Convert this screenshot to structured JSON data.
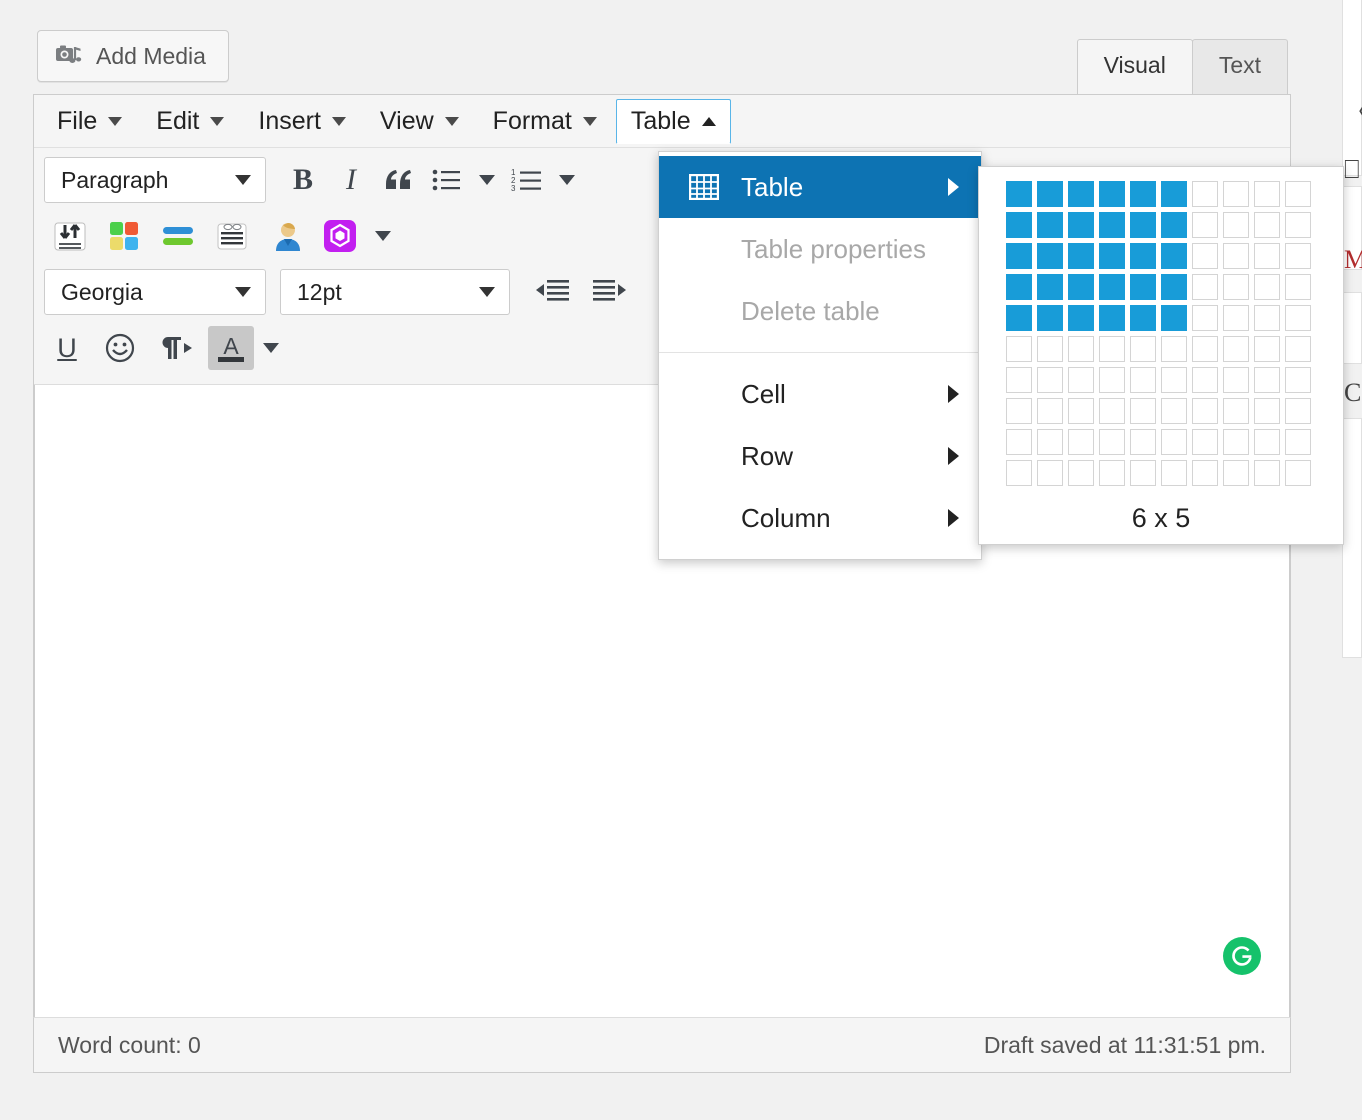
{
  "editor": {
    "add_media_label": "Add Media",
    "add_media_icon": "media-camera-music-icon",
    "tabs": [
      {
        "label": "Visual",
        "active": true
      },
      {
        "label": "Text",
        "active": false
      }
    ],
    "menubar": [
      {
        "label": "File",
        "caret": "down",
        "open": false
      },
      {
        "label": "Edit",
        "caret": "down",
        "open": false
      },
      {
        "label": "Insert",
        "caret": "down",
        "open": false
      },
      {
        "label": "View",
        "caret": "down",
        "open": false
      },
      {
        "label": "Format",
        "caret": "down",
        "open": false
      },
      {
        "label": "Table",
        "caret": "up",
        "open": true
      }
    ],
    "toolbar": {
      "paragraph_style": "Paragraph",
      "font_family": "Georgia",
      "font_size": "12pt",
      "bold_glyph": "B",
      "italic_glyph": "I",
      "quote_glyph": "“",
      "underline_glyph": "U",
      "icons_row1": [
        "bold-icon",
        "italic-icon",
        "blockquote-icon",
        "bulleted-list-icon",
        "bulleted-list-caret-icon",
        "numbered-list-icon",
        "numbered-list-caret-icon"
      ],
      "icons_row2": [
        "import-export-icon",
        "color-blocks-icon",
        "bars-icon",
        "lined-card-icon",
        "person-avatar-icon",
        "purple-hexagon-icon",
        "purple-hexagon-caret-icon"
      ],
      "icons_row3": [
        "outdent-icon",
        "indent-icon",
        "clipboard-icon"
      ],
      "icons_row4": [
        "underline-icon",
        "emoji-icon",
        "text-direction-icon",
        "text-color-icon",
        "text-color-caret-icon"
      ]
    },
    "statusbar": {
      "word_count": "Word count: 0",
      "draft_saved": "Draft saved at 11:31:51 pm."
    },
    "grammarly_badge": "grammarly-icon"
  },
  "table_menu": {
    "items": [
      {
        "label": "Table",
        "icon": "table-grid-icon",
        "highlighted": true,
        "disabled": false,
        "submenu": true
      },
      {
        "label": "Table properties",
        "icon": "",
        "highlighted": false,
        "disabled": true,
        "submenu": false
      },
      {
        "label": "Delete table",
        "icon": "",
        "highlighted": false,
        "disabled": true,
        "submenu": false
      },
      {
        "label": "Cell",
        "icon": "",
        "highlighted": false,
        "disabled": false,
        "submenu": true
      },
      {
        "label": "Row",
        "icon": "",
        "highlighted": false,
        "disabled": false,
        "submenu": true
      },
      {
        "label": "Column",
        "icon": "",
        "highlighted": false,
        "disabled": false,
        "submenu": true
      }
    ],
    "highlight_color": "#0d73b3",
    "disabled_color": "#a8a8a8"
  },
  "grid_picker": {
    "total_cols": 10,
    "total_rows": 10,
    "selected_cols": 6,
    "selected_rows": 5,
    "label": "6 x 5",
    "selected_color": "#189cd8"
  }
}
